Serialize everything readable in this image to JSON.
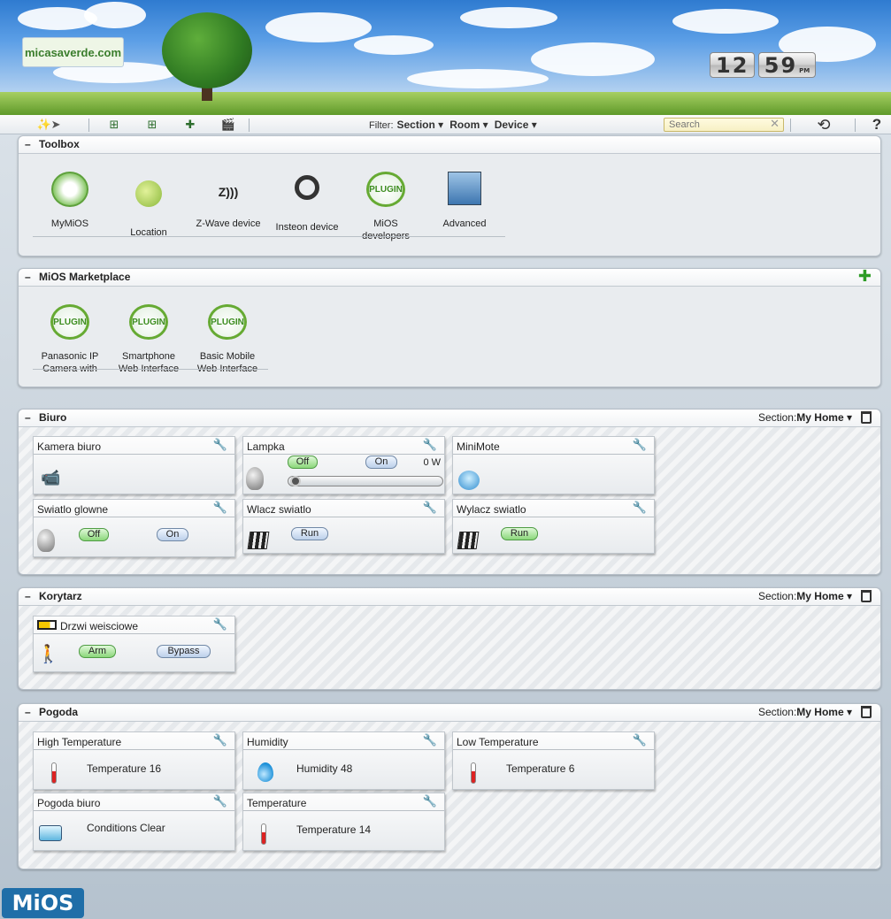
{
  "header": {
    "logo": "micasaverde.com",
    "clock": {
      "hour": "12",
      "minute": "59",
      "ampm": "PM"
    }
  },
  "toolbar": {
    "filter_label": "Filter:",
    "filters": [
      "Section ▾",
      "Room ▾",
      "Device ▾"
    ],
    "search_placeholder": "Search",
    "help": "?"
  },
  "toolbox": {
    "title": "Toolbox",
    "items": [
      {
        "label": "MyMiOS",
        "icon": "house-icon"
      },
      {
        "label": "Location",
        "icon": "globe-icon"
      },
      {
        "label": "Z-Wave device",
        "icon": "zwave-icon"
      },
      {
        "label": "Insteon device",
        "icon": "insteon-icon"
      },
      {
        "label": "MiOS developers",
        "icon": "plugin-icon"
      },
      {
        "label": "Advanced",
        "icon": "magnifier-icon"
      }
    ]
  },
  "marketplace": {
    "title": "MiOS Marketplace",
    "plugin_text": "PLUGIN",
    "items": [
      {
        "label": "Panasonic IP Camera with"
      },
      {
        "label": "Smartphone Web Interface"
      },
      {
        "label": "Basic Mobile Web Interface"
      }
    ]
  },
  "rooms": [
    {
      "title": "Biuro",
      "section_label": "Section:",
      "section_value": "My Home ▾",
      "devices": [
        {
          "name": "Kamera biuro"
        },
        {
          "name": "Lampka",
          "off": "Off",
          "on": "On",
          "power": "0 W"
        },
        {
          "name": "MiniMote"
        },
        {
          "name": "Swiatlo glowne",
          "off": "Off",
          "on": "On"
        },
        {
          "name": "Wlacz swiatlo",
          "run": "Run"
        },
        {
          "name": "Wylacz swiatlo",
          "run": "Run"
        }
      ]
    },
    {
      "title": "Korytarz",
      "section_label": "Section:",
      "section_value": "My Home ▾",
      "devices": [
        {
          "name": "Drzwi weisciowe",
          "arm": "Arm",
          "bypass": "Bypass"
        }
      ]
    },
    {
      "title": "Pogoda",
      "section_label": "Section:",
      "section_value": "My Home ▾",
      "devices": [
        {
          "name": "High Temperature",
          "value": "Temperature 16"
        },
        {
          "name": "Humidity",
          "value": "Humidity 48"
        },
        {
          "name": "Low Temperature",
          "value": "Temperature 6"
        },
        {
          "name": "Pogoda biuro",
          "value": "Conditions Clear"
        },
        {
          "name": "Temperature",
          "value": "Temperature 14"
        }
      ]
    }
  ],
  "footer": {
    "logo": "MiOS"
  }
}
